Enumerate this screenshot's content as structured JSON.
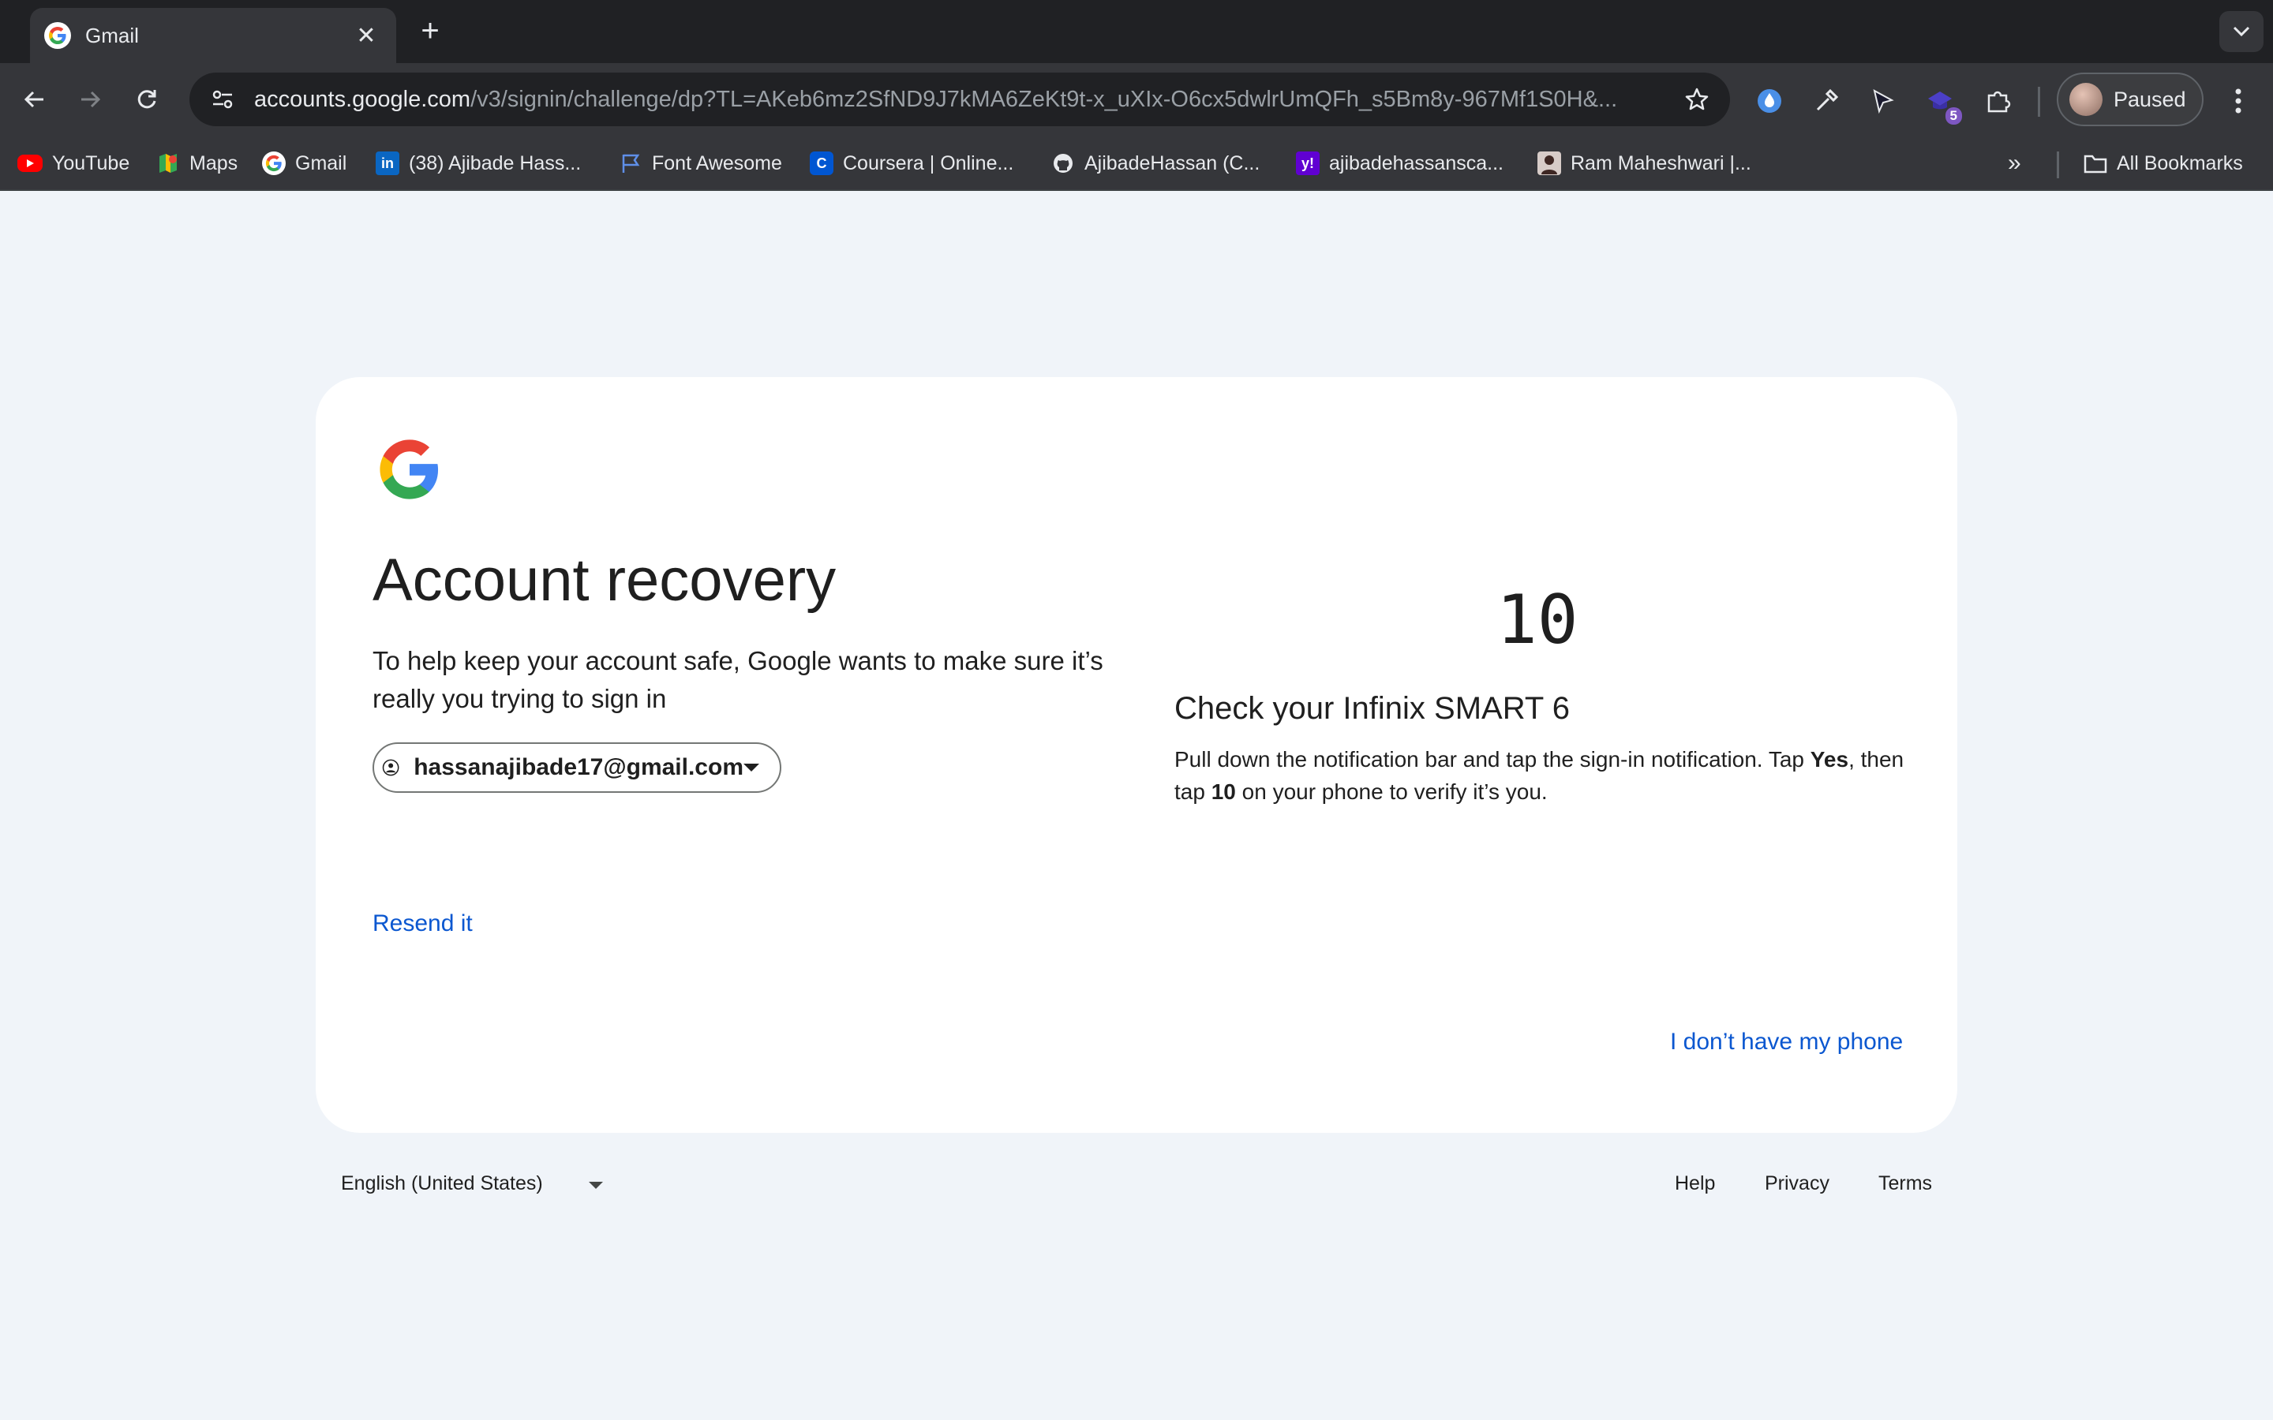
{
  "browser": {
    "tab_title": "Gmail",
    "url_host": "accounts.google.com",
    "url_rest": "/v3/signin/challenge/dp?TL=AKeb6mz2SfND9J7kMA6ZeKt9t-x_uXIx-O6cx5dwlrUmQFh_s5Bm8y-967Mf1S0H&...",
    "extension_badge": "5",
    "profile_label": "Paused",
    "bookmarks": [
      {
        "label": "YouTube",
        "icon": "youtube-icon"
      },
      {
        "label": "Maps",
        "icon": "maps-icon"
      },
      {
        "label": "Gmail",
        "icon": "google-icon"
      },
      {
        "label": "(38) Ajibade Hass...",
        "icon": "linkedin-icon"
      },
      {
        "label": "Font Awesome",
        "icon": "flag-icon"
      },
      {
        "label": "Coursera | Online...",
        "icon": "coursera-icon"
      },
      {
        "label": "AjibadeHassan (C...",
        "icon": "github-icon"
      },
      {
        "label": "ajibadehassansca...",
        "icon": "yahoo-icon"
      },
      {
        "label": "Ram Maheshwari |...",
        "icon": "portrait-icon"
      }
    ],
    "all_bookmarks": "All Bookmarks"
  },
  "page": {
    "heading": "Account recovery",
    "description": "To help keep your account safe, Google wants to make sure it’s really you trying to sign in",
    "email": "hassanajibade17@gmail.com",
    "resend": "Resend it",
    "number": "10",
    "check_title": "Check your Infinix SMART 6",
    "check_body_1": "Pull down the notification bar and tap the sign-in notification. Tap ",
    "check_body_yes": "Yes",
    "check_body_2": ", then tap ",
    "check_body_num": "10",
    "check_body_3": " on your phone to verify it’s you.",
    "no_phone": "I don’t have my phone"
  },
  "footer": {
    "language": "English (United States)",
    "help": "Help",
    "privacy": "Privacy",
    "terms": "Terms"
  },
  "colors": {
    "link": "#0b57d0",
    "page_bg": "#f0f4f9",
    "chrome_dark": "#202124",
    "chrome_toolbar": "#35363a"
  }
}
